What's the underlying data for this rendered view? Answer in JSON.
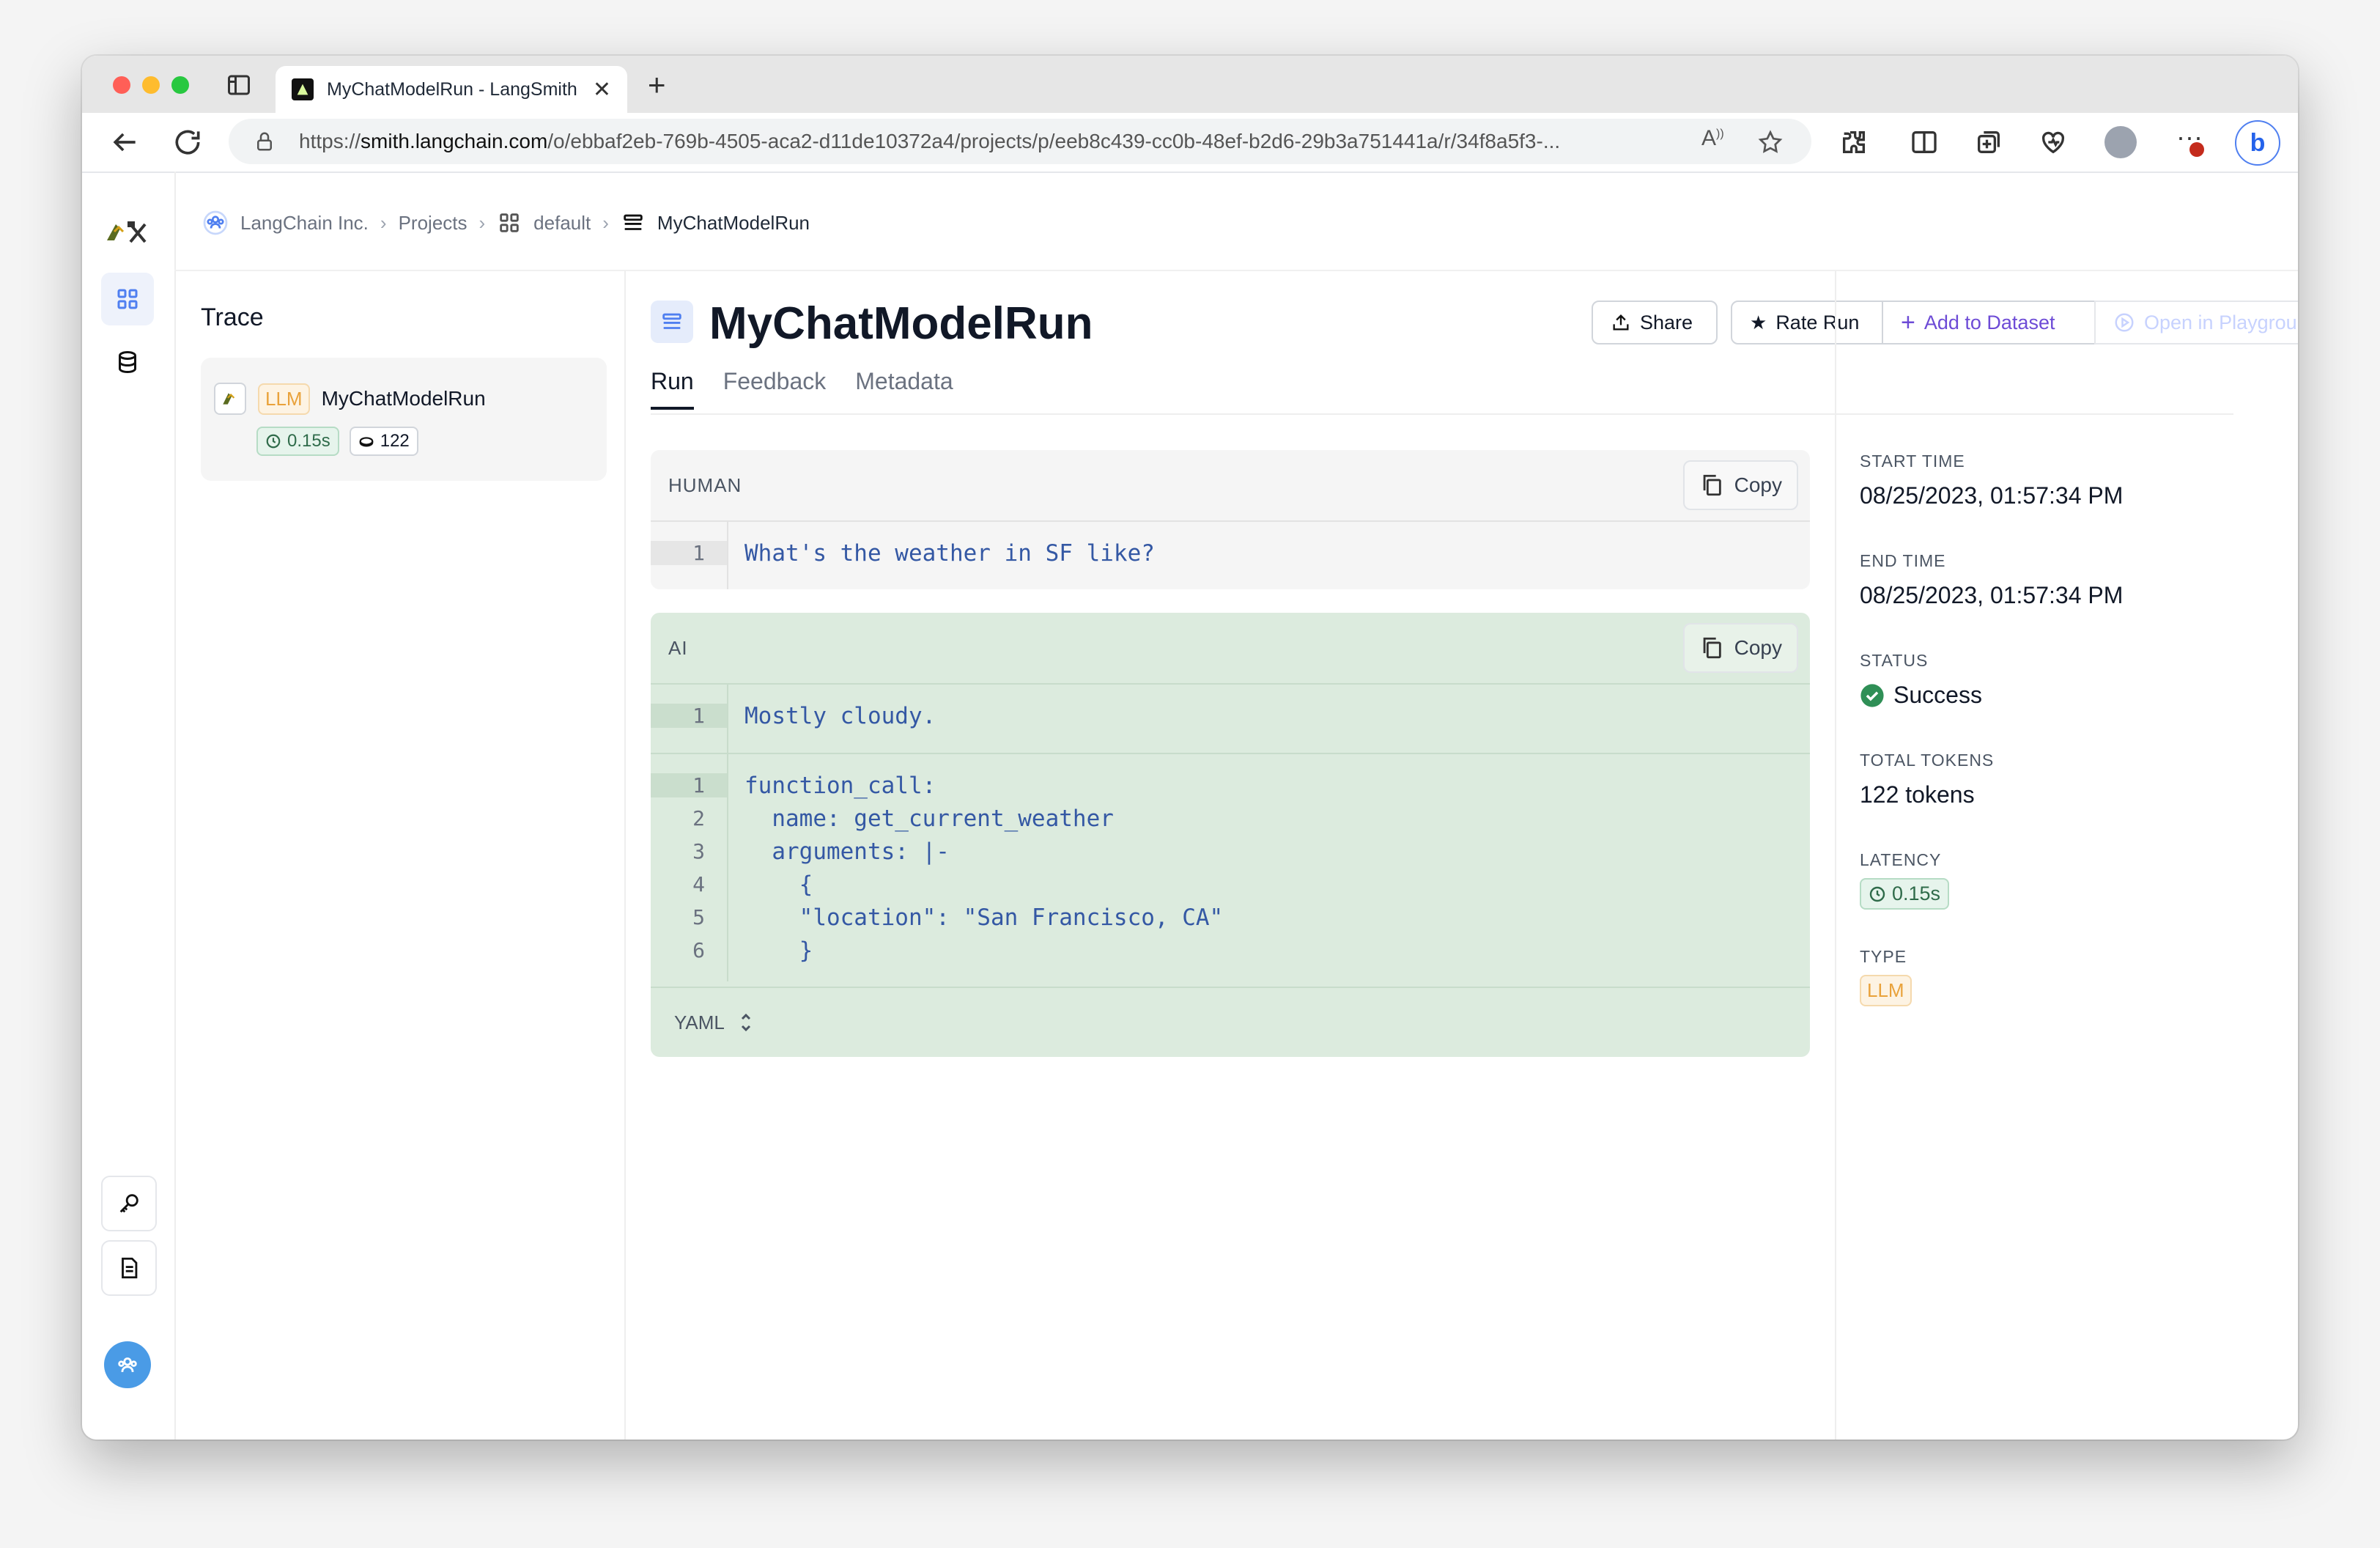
{
  "browser": {
    "tab_title": "MyChatModelRun - LangSmith",
    "url_prefix": "https://",
    "url_host": "smith.langchain.com",
    "url_path": "/o/ebbaf2eb-769b-4505-aca2-d11de10372a4/projects/p/eeb8c439-cc0b-48ef-b2d6-29b3a751441a/r/34f8a5f3-..."
  },
  "breadcrumb": {
    "org": "LangChain Inc.",
    "projects": "Projects",
    "project": "default",
    "current": "MyChatModelRun"
  },
  "trace": {
    "title": "Trace",
    "item": {
      "type": "LLM",
      "name": "MyChatModelRun",
      "latency": "0.15s",
      "tokens": "122"
    }
  },
  "run": {
    "title": "MyChatModelRun",
    "buttons": {
      "share": "Share",
      "rate": "Rate Run",
      "add_dataset": "Add to Dataset",
      "playground": "Open in Playground"
    },
    "tabs": [
      "Run",
      "Feedback",
      "Metadata"
    ],
    "messages": {
      "human": {
        "role": "HUMAN",
        "copy": "Copy",
        "lines": [
          "What's the weather in SF like?"
        ]
      },
      "ai": {
        "role": "AI",
        "copy": "Copy",
        "content_lines": [
          "Mostly cloudy."
        ],
        "function_lines": [
          "function_call:",
          "  name: get_current_weather",
          "  arguments: |-",
          "    {",
          "    \"location\": \"San Francisco, CA\"",
          "    }"
        ],
        "format": "YAML"
      }
    }
  },
  "details": {
    "start_time_label": "START TIME",
    "start_time": "08/25/2023, 01:57:34 PM",
    "end_time_label": "END TIME",
    "end_time": "08/25/2023, 01:57:34 PM",
    "status_label": "STATUS",
    "status": "Success",
    "tokens_label": "TOTAL TOKENS",
    "tokens": "122 tokens",
    "latency_label": "LATENCY",
    "latency": "0.15s",
    "type_label": "TYPE",
    "type": "LLM"
  },
  "colors": {
    "accent": "#4f7ff0",
    "success": "#2f8f56",
    "llm": "#e9a23b",
    "ai_bg": "#dcebde",
    "dataset": "#6d4bd6"
  }
}
